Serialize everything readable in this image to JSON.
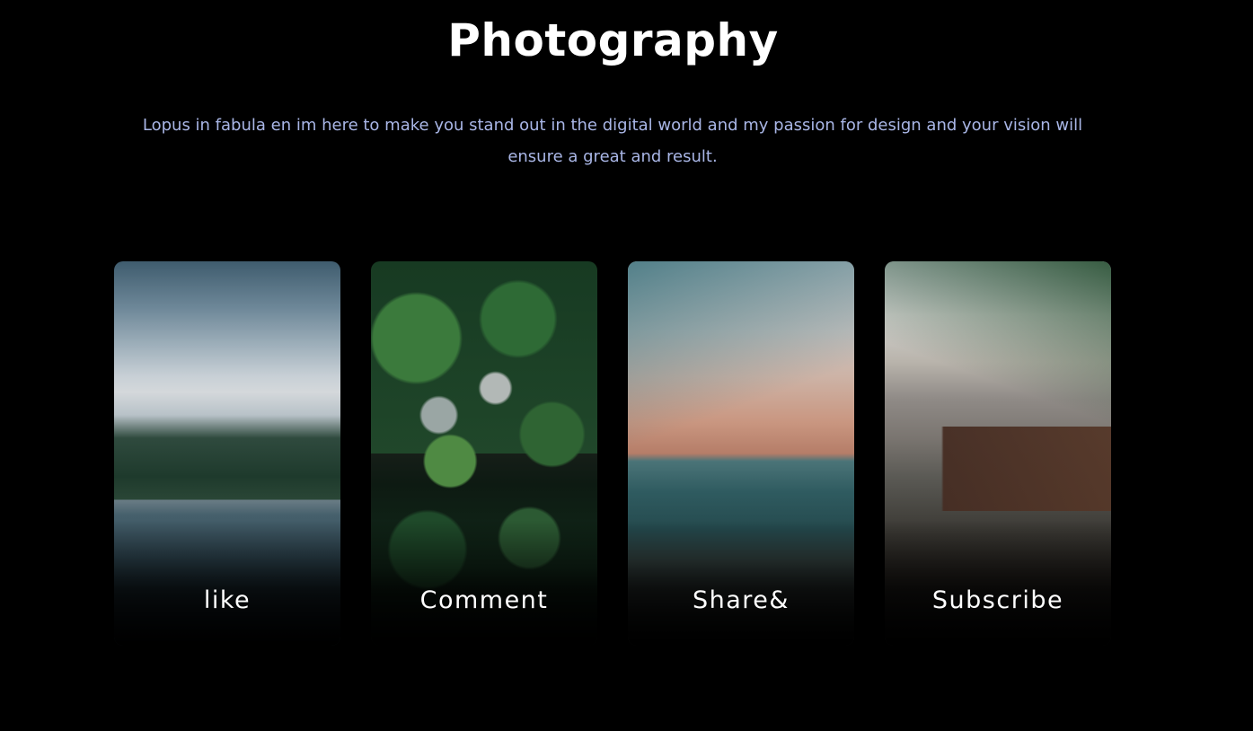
{
  "header": {
    "title": "Photography",
    "description": "Lopus in fabula en im here to make you stand out in the digital world and my passion for design and your vision will ensure a great and result."
  },
  "cards": [
    {
      "label": "like",
      "image": "misty-forest-lake-photo"
    },
    {
      "label": "Comment",
      "image": "aerial-forest-photo"
    },
    {
      "label": "Share&",
      "image": "valley-dusk-photo"
    },
    {
      "label": "Subscribe",
      "image": "mountain-cabin-photo"
    }
  ],
  "colors": {
    "background": "#000000",
    "title": "#ffffff",
    "description": "#a9b6e6",
    "card_label": "#ffffff"
  }
}
